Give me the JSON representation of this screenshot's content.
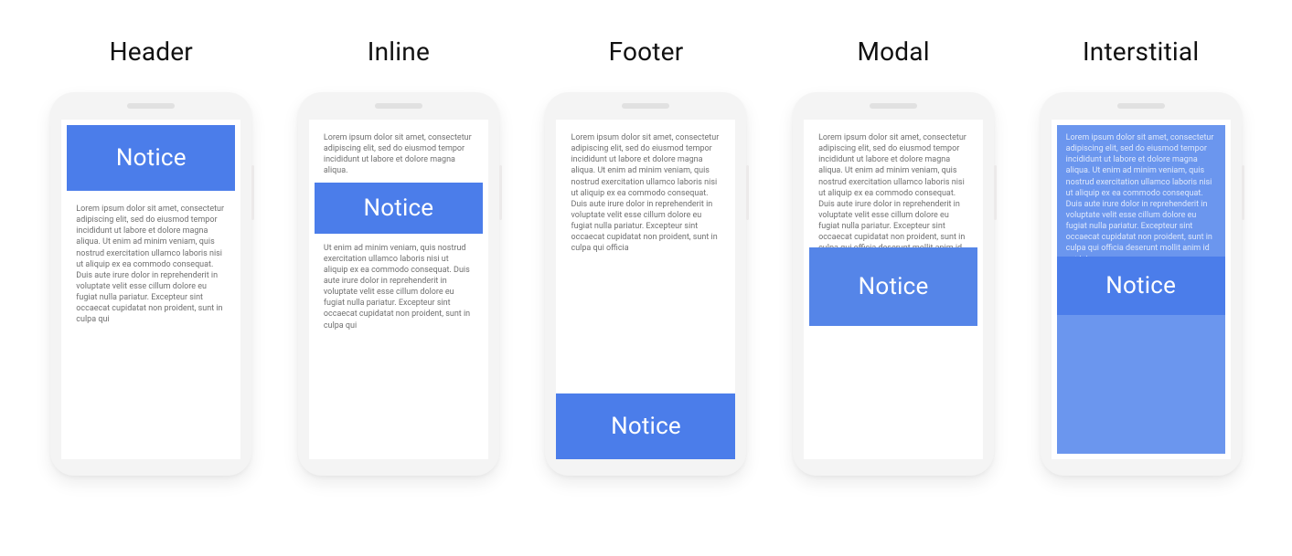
{
  "notice_label": "Notice",
  "lorem_short": "Lorem ipsum dolor sit amet, consectetur adipiscing elit, sed do eiusmod tempor incididunt ut labore et dolore magna aliqua. Ut enim ad minim veniam, quis nostrud exercitation ullamco laboris nisi ut aliquip ex ea commodo consequat. Duis aute irure dolor in reprehenderit in voluptate velit esse cillum dolore eu fugiat nulla pariatur. Excepteur sint occaecat cupidatat non proident, sunt in culpa qui",
  "lorem_top": "Lorem ipsum dolor sit amet, consectetur adipiscing elit, sed do eiusmod tempor incididunt ut labore et dolore magna aliqua.",
  "lorem_bottom": "Ut enim ad minim veniam, quis nostrud exercitation ullamco laboris nisi ut aliquip ex ea commodo consequat. Duis aute irure dolor in reprehenderit in voluptate velit esse cillum dolore eu fugiat nulla pariatur. Excepteur sint occaecat cupidatat non proident, sunt in culpa qui",
  "lorem_footer": "Lorem ipsum dolor sit amet, consectetur adipiscing elit, sed do eiusmod tempor incididunt ut labore et dolore magna aliqua. Ut enim ad minim veniam, quis nostrud exercitation ullamco laboris nisi ut aliquip ex ea commodo consequat. Duis aute irure dolor in reprehenderit in voluptate velit esse cillum dolore eu fugiat nulla pariatur. Excepteur sint occaecat cupidatat non proident, sunt in culpa qui officia",
  "lorem_modal": "Lorem ipsum dolor sit amet, consectetur adipiscing elit, sed do eiusmod tempor incididunt ut labore et dolore magna aliqua. Ut enim ad minim veniam, quis nostrud exercitation ullamco laboris nisi ut aliquip ex ea commodo consequat. Duis aute irure dolor in reprehenderit in voluptate velit esse cillum dolore eu fugiat nulla pariatur. Excepteur sint occaecat cupidatat non proident, sunt in culpa qui officia deserunt mollit anim id est laborum.",
  "lorem_inter": "Lorem ipsum dolor sit amet, consectetur adipiscing elit, sed do eiusmod tempor incididunt ut labore et dolore magna aliqua. Ut enim ad minim veniam, quis nostrud exercitation ullamco laboris nisi ut aliquip ex ea commodo consequat. Duis aute irure dolor in reprehenderit in voluptate velit esse cillum dolore eu fugiat nulla pariatur. Excepteur sint occaecat cupidatat non proident, sunt in culpa qui officia deserunt mollit anim id est laborum.",
  "variants": {
    "header": "Header",
    "inline": "Inline",
    "footer": "Footer",
    "modal": "Modal",
    "interstitial": "Interstitial"
  }
}
